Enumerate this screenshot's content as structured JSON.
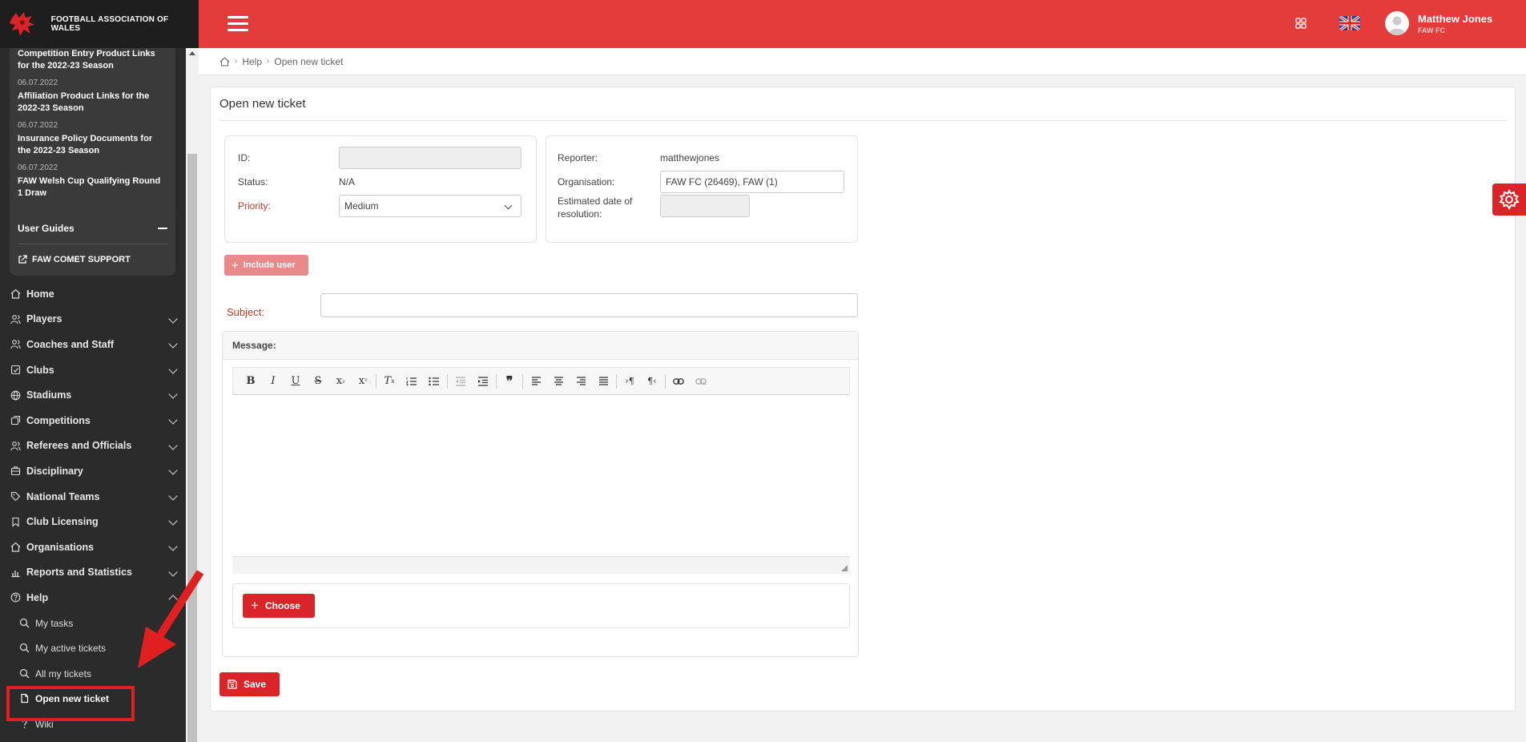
{
  "brand": {
    "name": "FOOTBALL ASSOCIATION OF WALES"
  },
  "news": [
    {
      "date": "",
      "title": "Competition Entry Product Links for the 2022-23 Season"
    },
    {
      "date": "06.07.2022",
      "title": "Affiliation Product Links for the 2022-23 Season"
    },
    {
      "date": "06.07.2022",
      "title": "Insurance Policy Documents for the 2022-23 Season"
    },
    {
      "date": "06.07.2022",
      "title": "FAW Welsh Cup Qualifying Round 1 Draw"
    }
  ],
  "guides": {
    "title": "User Guides",
    "link": "FAW COMET SUPPORT"
  },
  "nav": {
    "items": [
      {
        "label": "Home"
      },
      {
        "label": "Players"
      },
      {
        "label": "Coaches and Staff"
      },
      {
        "label": "Clubs"
      },
      {
        "label": "Stadiums"
      },
      {
        "label": "Competitions"
      },
      {
        "label": "Referees and Officials"
      },
      {
        "label": "Disciplinary"
      },
      {
        "label": "National Teams"
      },
      {
        "label": "Club Licensing"
      },
      {
        "label": "Organisations"
      },
      {
        "label": "Reports and Statistics"
      },
      {
        "label": "Help"
      }
    ],
    "help_sub": [
      {
        "label": "My tasks"
      },
      {
        "label": "My active tickets"
      },
      {
        "label": "All my tickets"
      },
      {
        "label": "Open new ticket"
      },
      {
        "label": "Wiki"
      }
    ]
  },
  "user": {
    "name": "Matthew Jones",
    "org": "FAW FC"
  },
  "breadcrumb": {
    "help": "Help",
    "current": "Open new ticket"
  },
  "form": {
    "title": "Open new ticket",
    "id_label": "ID:",
    "id_value": "",
    "status_label": "Status:",
    "status_value": "N/A",
    "priority_label": "Priority:",
    "priority_value": "Medium",
    "reporter_label": "Reporter:",
    "reporter_value": "matthewjones",
    "organisation_label": "Organisation:",
    "organisation_value": "FAW FC (26469), FAW (1)",
    "resolution_label_1": "Estimated date of",
    "resolution_label_2": "resolution:",
    "resolution_value": "",
    "include_user": "Include user",
    "subject_label": "Subject:",
    "subject_value": "",
    "message_label": "Message:",
    "choose_label": "Choose",
    "save_label": "Save"
  },
  "colors": {
    "brand_red": "#e43b3b",
    "button_red": "#d9252a",
    "sidebar": "#2b2b2b"
  }
}
